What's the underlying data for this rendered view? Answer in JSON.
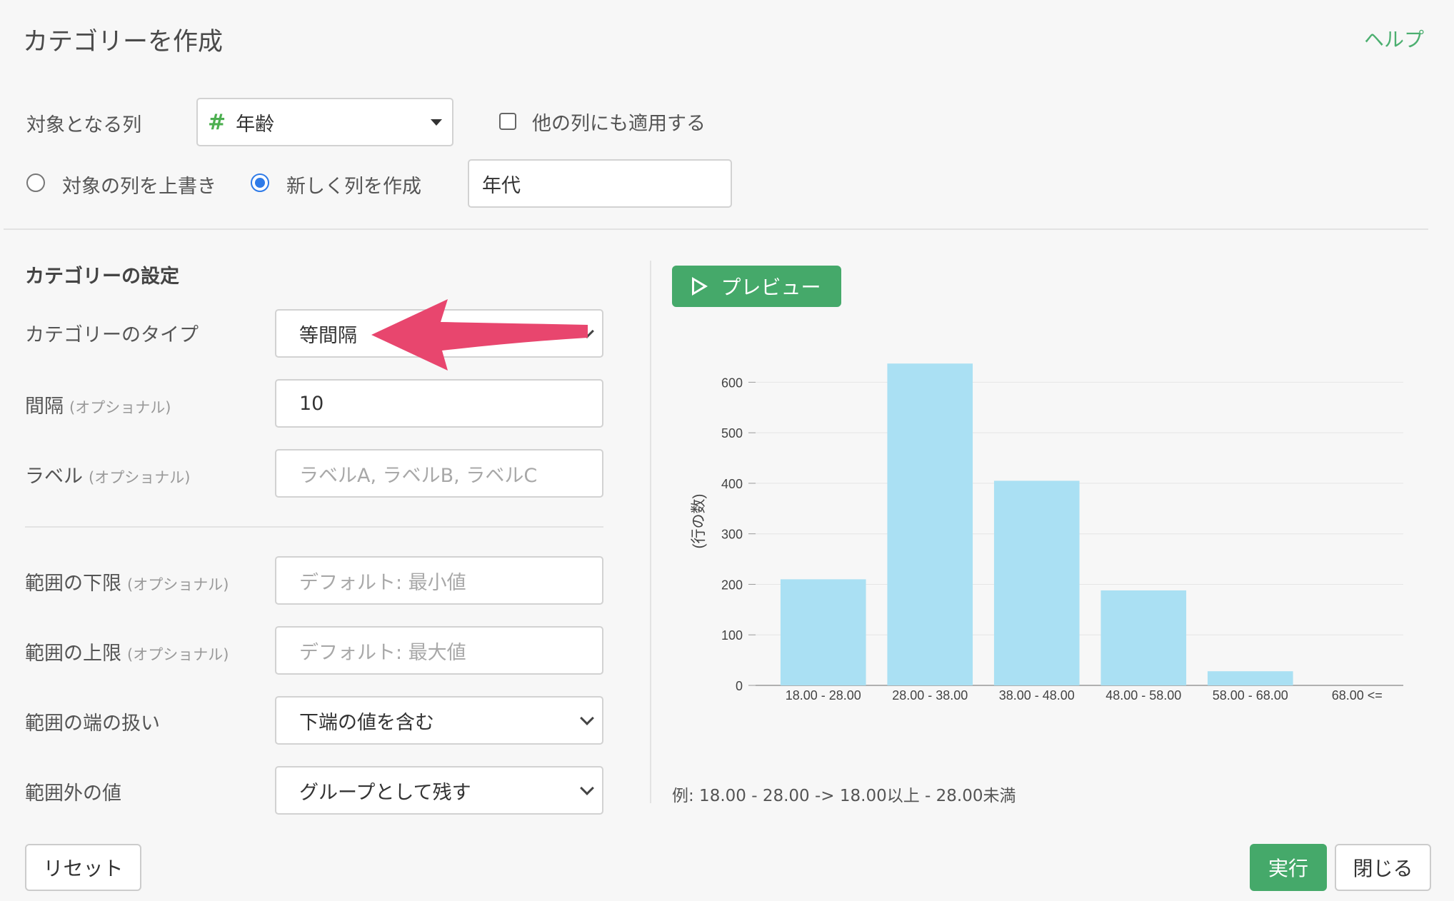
{
  "header": {
    "title": "カテゴリーを作成",
    "help": "ヘルプ"
  },
  "target": {
    "label": "対象となる列",
    "column_icon": "#",
    "column_value": "年齢",
    "apply_other_label": "他の列にも適用する",
    "overwrite_label": "対象の列を上書き",
    "new_column_label": "新しく列を作成",
    "new_column_value": "年代"
  },
  "settings": {
    "section_title": "カテゴリーの設定",
    "type_label": "カテゴリーのタイプ",
    "type_value": "等間隔",
    "interval_label": "間隔",
    "interval_value": "10",
    "label_label": "ラベル",
    "label_placeholder": "ラベルA, ラベルB, ラベルC",
    "optional": "(オプショナル)",
    "lower_label": "範囲の下限",
    "lower_placeholder": "デフォルト: 最小値",
    "upper_label": "範囲の上限",
    "upper_placeholder": "デフォルト: 最大値",
    "edge_label": "範囲の端の扱い",
    "edge_value": "下端の値を含む",
    "outside_label": "範囲外の値",
    "outside_value": "グループとして残す"
  },
  "preview": {
    "button": "プレビュー",
    "example": "例: 18.00 - 28.00 -> 18.00以上 - 28.00未満"
  },
  "chart_data": {
    "type": "bar",
    "categories": [
      "18.00 - 28.00",
      "28.00 - 38.00",
      "38.00 - 48.00",
      "48.00 - 58.00",
      "58.00 - 68.00",
      "68.00 <="
    ],
    "values": [
      210,
      637,
      405,
      188,
      28,
      0
    ],
    "ylabel": "(行の数)",
    "yticks": [
      0,
      100,
      200,
      300,
      400,
      500,
      600
    ],
    "ylim": [
      0,
      650
    ],
    "grid": true,
    "color": "#aae0f3"
  },
  "footer": {
    "reset": "リセット",
    "run": "実行",
    "close": "閉じる"
  },
  "colors": {
    "accent_green": "#45a96a",
    "annotation_arrow": "#e8466e",
    "radio_blue": "#2f7be8"
  }
}
